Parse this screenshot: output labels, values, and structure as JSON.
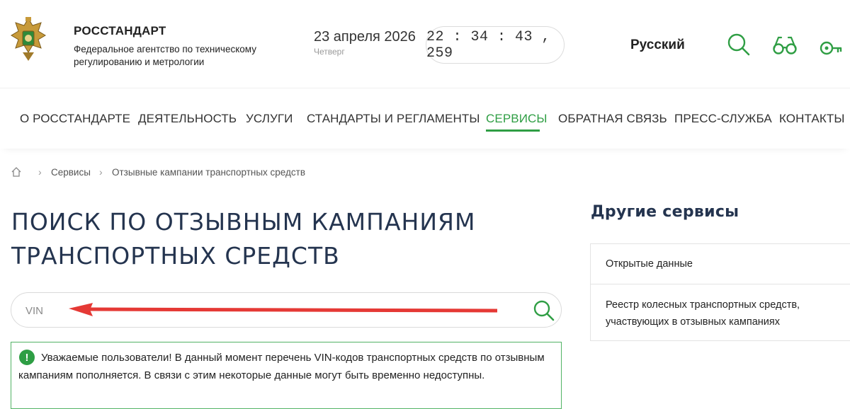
{
  "header": {
    "org_title": "РОССТАНДАРТ",
    "org_subtitle": "Федеральное агентство по техническому регулированию и метрологии",
    "date": "23 апреля 2026",
    "weekday": "Четверг",
    "clock": "22 : 34 : 43 , 259",
    "language": "Русский",
    "icons": [
      "search-icon",
      "glasses-icon",
      "key-icon"
    ],
    "accent_color": "#2f9e44"
  },
  "nav": {
    "items": [
      {
        "label": "О РОССТАНДАРТЕ"
      },
      {
        "label": "ДЕЯТЕЛЬНОСТЬ"
      },
      {
        "label": "УСЛУГИ"
      },
      {
        "label": "СТАНДАРТЫ И РЕГЛАМЕНТЫ"
      },
      {
        "label": "СЕРВИСЫ",
        "active": true
      },
      {
        "label": "ОБРАТНАЯ СВЯЗЬ"
      },
      {
        "label": "ПРЕСС-СЛУЖБА"
      },
      {
        "label": "КОНТАКТЫ"
      }
    ]
  },
  "breadcrumb": {
    "items": [
      "Сервисы",
      "Отзывные кампании транспортных средств"
    ]
  },
  "main": {
    "title_line1": "ПОИСК ПО ОТЗЫВНЫМ КАМПАНИЯМ",
    "title_line2": "ТРАНСПОРТНЫХ СРЕДСТВ",
    "search_placeholder": "VIN",
    "notice_icon": "!",
    "notice": "Уважаемые пользователи! В данный момент перечень VIN-кодов транспортных средств по отзывным кампаниям пополняется. В связи с этим некоторые данные могут быть временно недоступны."
  },
  "sidebar": {
    "title": "Другие сервисы",
    "items": [
      {
        "label": "Открытые данные"
      },
      {
        "label": "Реестр колесных транспортных средств, участвующих в отзывных кампаниях"
      }
    ]
  }
}
